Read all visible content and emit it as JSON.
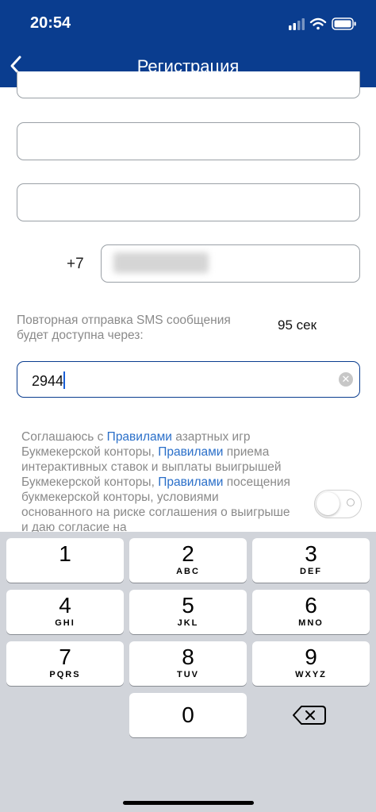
{
  "status_bar": {
    "time": "20:54"
  },
  "nav": {
    "title": "Регистрация"
  },
  "form": {
    "phone_prefix": "+7",
    "sms_resend_text": "Повторная отправка SMS сообщения будет доступна через:",
    "sms_timer": "95 сек",
    "code_value": "2944"
  },
  "agreement": {
    "part1": "Соглашаюсь с ",
    "link1": "Правилами",
    "part2": " азартных игр Букмекерской конторы, ",
    "link2": "Правилами",
    "part3": " приема интерактивных ставок и выплаты выигрышей Букмекерской конторы, ",
    "link3": "Правилами",
    "part4": " посещения букмекерской конторы, условиями основанного на риске соглашения о выигрыше и даю согласие на"
  },
  "keyboard": {
    "keys": [
      {
        "num": "1",
        "letters": ""
      },
      {
        "num": "2",
        "letters": "ABC"
      },
      {
        "num": "3",
        "letters": "DEF"
      },
      {
        "num": "4",
        "letters": "GHI"
      },
      {
        "num": "5",
        "letters": "JKL"
      },
      {
        "num": "6",
        "letters": "MNO"
      },
      {
        "num": "7",
        "letters": "PQRS"
      },
      {
        "num": "8",
        "letters": "TUV"
      },
      {
        "num": "9",
        "letters": "WXYZ"
      },
      {
        "num": "0",
        "letters": ""
      }
    ]
  },
  "colors": {
    "header_bg": "#0a3d8f",
    "link": "#2a6fc9",
    "keyboard_bg": "#d1d4da"
  }
}
